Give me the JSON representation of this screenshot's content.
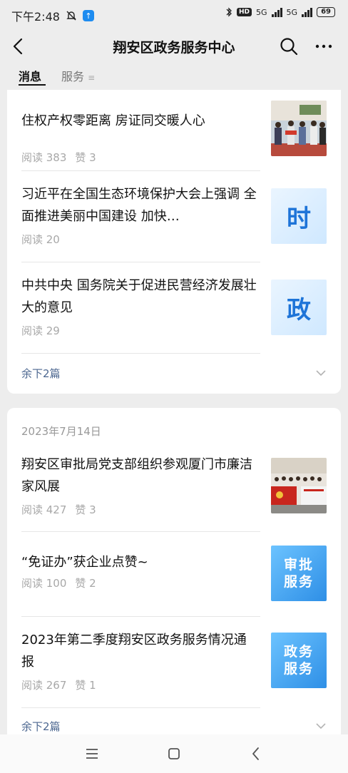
{
  "status": {
    "time": "下午2:48",
    "hd": "HD",
    "net1": "5G",
    "net2": "5G",
    "battery": "69"
  },
  "header": {
    "title": "翔安区政务服务中心"
  },
  "tabs": [
    {
      "label": "消息"
    },
    {
      "label": "服务"
    }
  ],
  "group1": {
    "articles": [
      {
        "title": "住权产权零距离 房证同交暖人心",
        "reads": "阅读 383",
        "likes": "赞 3",
        "thumb": "photo-ceremony"
      },
      {
        "title": "习近平在全国生态环境保护大会上强调 全面推进美丽中国建设 加快…",
        "reads": "阅读 20",
        "likes": "",
        "thumb_text": "时"
      },
      {
        "title": "中共中央 国务院关于促进民营经济发展壮大的意见",
        "reads": "阅读 29",
        "likes": "",
        "thumb_text": "政"
      }
    ],
    "fold_label": "余下2篇"
  },
  "group2": {
    "date": "2023年7月14日",
    "articles": [
      {
        "title": "翔安区审批局党支部组织参观厦门市廉洁家风展",
        "reads": "阅读 427",
        "likes": "赞 3",
        "thumb": "photo-group"
      },
      {
        "title": "“免证办”获企业点赞~",
        "reads": "阅读 100",
        "likes": "赞 2",
        "thumb_line1": "审批",
        "thumb_line2": "服务"
      },
      {
        "title": "2023年第二季度翔安区政务服务情况通报",
        "reads": "阅读 267",
        "likes": "赞 1",
        "thumb_line1": "政务",
        "thumb_line2": "服务"
      }
    ],
    "fold_label": "余下2篇"
  },
  "colors": {
    "accent_link": "#4c6790",
    "background": "#ededed"
  }
}
